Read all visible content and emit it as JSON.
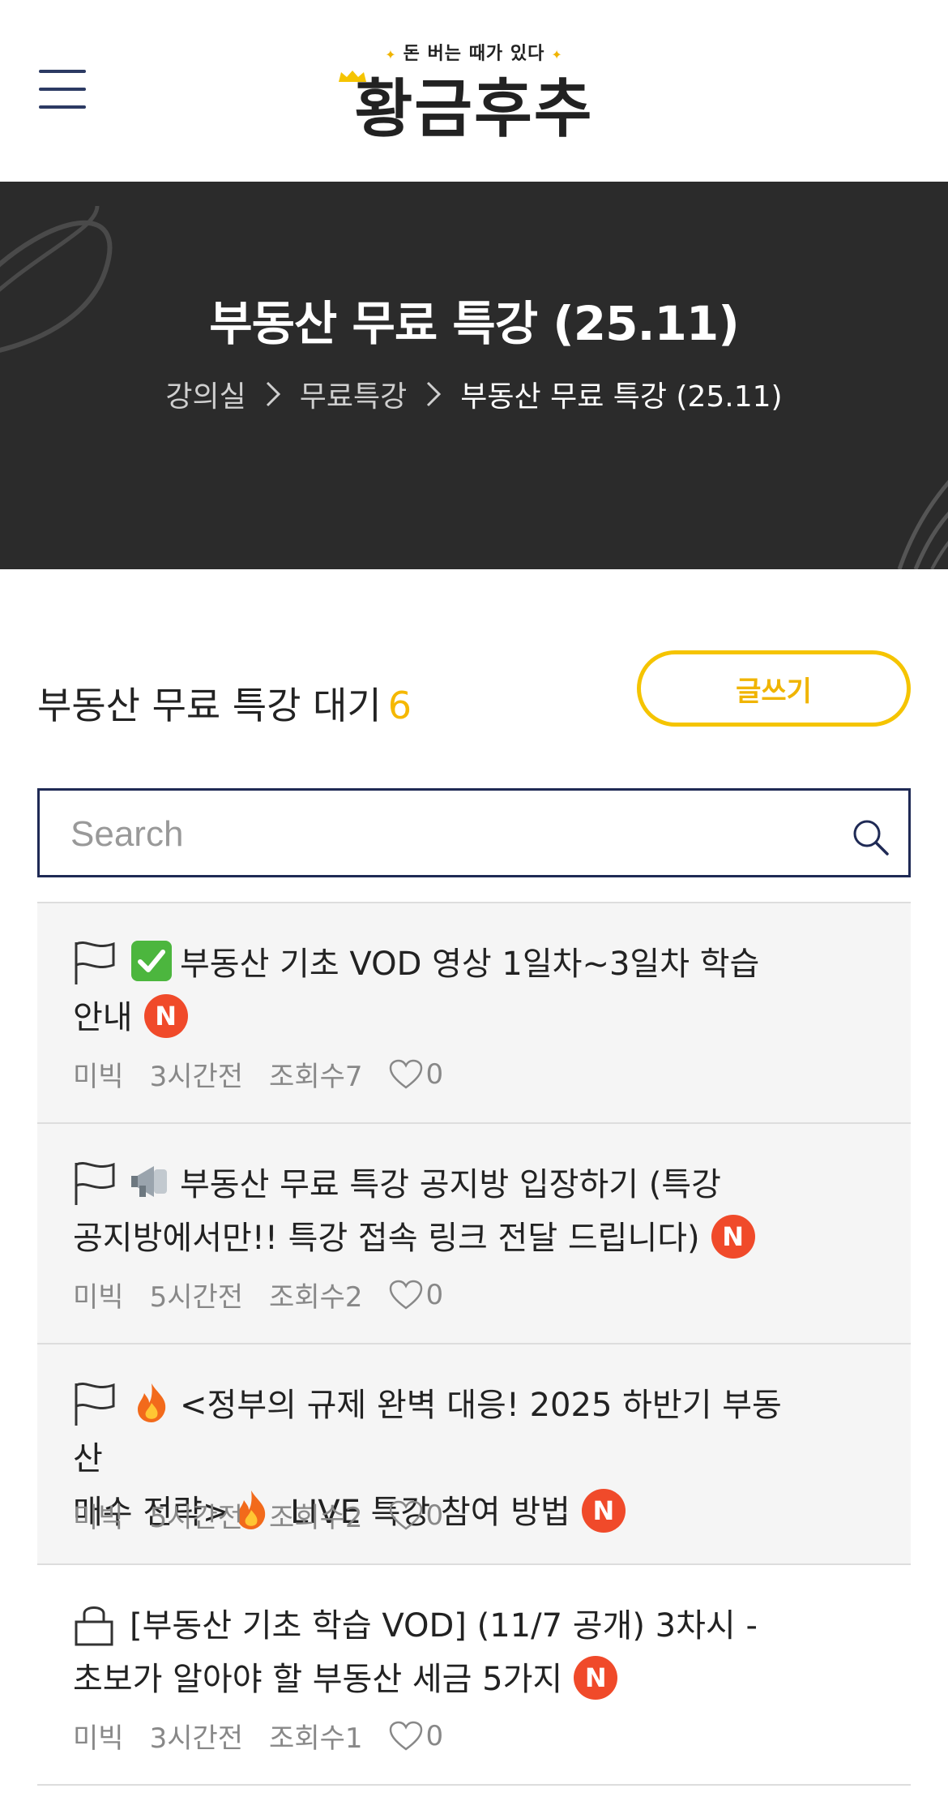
{
  "header": {
    "logo_tagline": "돈 버는 때가 있다",
    "logo_name": "황금후추",
    "menu_icon": "hamburger-icon"
  },
  "hero": {
    "title": "부동산 무료 특강 (25.11)",
    "breadcrumb": [
      "강의실",
      "무료특강",
      "부동산 무료 특강 (25.11)"
    ]
  },
  "board": {
    "title": "부동산 무료 특강 대기",
    "count": "6",
    "write_button": "글쓰기",
    "search_placeholder": "Search",
    "accent_color": "#f5c400",
    "badge_color": "#f04a2a"
  },
  "posts": [
    {
      "icon": "flag-icon",
      "emoji": "check-mark-emoji",
      "title_line1": "부동산 기초 VOD 영상 1일차~3일차 학습",
      "title_line2": "안내",
      "new_badge": "N",
      "author": "미빅",
      "time": "3시간전",
      "views": "조회수7",
      "likes": "0"
    },
    {
      "icon": "flag-icon",
      "emoji": "megaphone-emoji",
      "title_line1": "부동산 무료 특강 공지방 입장하기 (특강",
      "title_line2": "공지방에서만!! 특강 접속 링크 전달 드립니다)",
      "new_badge": "N",
      "author": "미빅",
      "time": "5시간전",
      "views": "조회수2",
      "likes": "0"
    },
    {
      "icon": "flag-icon",
      "emoji": "fire-emoji",
      "title_line1": "<정부의 규제 완벽 대응! 2025 하반기 부동산",
      "title_line2_a": "매수 전략>",
      "title_line2_b": " LIVE 특강 참여 방법",
      "new_badge": "N",
      "author": "미빅",
      "time": "5시간전",
      "views": "조회수2",
      "likes": "0"
    },
    {
      "icon": "lock-icon",
      "title_line1": "[부동산 기초 학습 VOD] (11/7 공개) 3차시 -",
      "title_line2": "초보가 알아야 할 부동산 세금 5가지",
      "new_badge": "N",
      "author": "미빅",
      "time": "3시간전",
      "views": "조회수1",
      "likes": "0"
    }
  ]
}
